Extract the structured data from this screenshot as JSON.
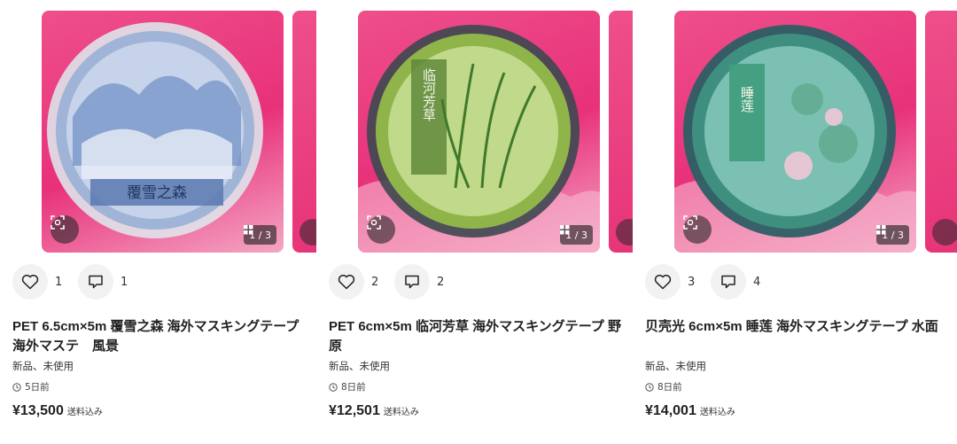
{
  "listings": [
    {
      "likes": "1",
      "comments": "1",
      "title": "PET 6.5cm×5m 覆雪之森 海外マスキングテープ　海外マステ　風景",
      "condition": "新品、未使用",
      "posted": "5日前",
      "price": "¥13,500",
      "shipping": "送料込み",
      "image_counter": "1 / 3",
      "tape_label": "覆雪之森",
      "tape_colors": {
        "bg": "#9fb4d6",
        "inner": "#c6d3ea",
        "band": "#5a78b0"
      }
    },
    {
      "likes": "2",
      "comments": "2",
      "title": "PET 6cm×5m 临河芳草 海外マスキングテープ 野原",
      "condition": "新品、未使用",
      "posted": "8日前",
      "price": "¥12,501",
      "shipping": "送料込み",
      "image_counter": "1 / 3",
      "tape_label": "临河芳草",
      "tape_colors": {
        "bg": "#8fb54a",
        "inner": "#c1d98a",
        "band": "#3f5a3c"
      }
    },
    {
      "likes": "3",
      "comments": "4",
      "title": "贝壳光 6cm×5m 睡莲 海外マスキングテープ 水面",
      "condition": "新品、未使用",
      "posted": "8日前",
      "price": "¥14,001",
      "shipping": "送料込み",
      "image_counter": "1 / 3",
      "tape_label": "睡莲",
      "tape_colors": {
        "bg": "#3f8f80",
        "inner": "#7cc0b4",
        "band": "#2c5f64"
      }
    }
  ],
  "icons": {
    "like": "heart-outline-icon",
    "comment": "speech-bubble-icon",
    "time": "clock-icon",
    "lens": "visual-search-icon",
    "gallery": "grid-icon"
  },
  "colors": {
    "photo_bg": "#e8317a",
    "button_bg": "#f2f2f2",
    "text": "#222222"
  }
}
